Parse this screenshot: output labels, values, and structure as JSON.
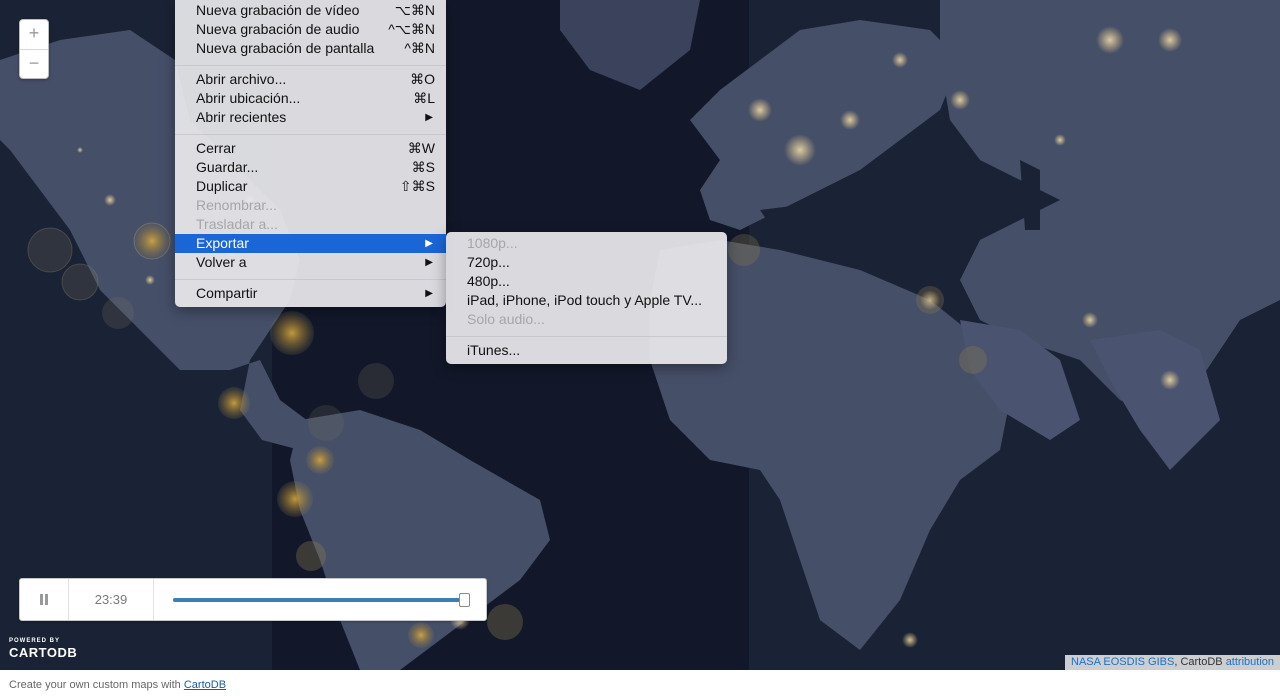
{
  "file_menu": {
    "items": [
      {
        "label": "Nueva grabación de vídeo",
        "shortcut": "⌥⌘N",
        "enabled": true
      },
      {
        "label": "Nueva grabación de audio",
        "shortcut": "^⌥⌘N",
        "enabled": true
      },
      {
        "label": "Nueva grabación de pantalla",
        "shortcut": "^⌘N",
        "enabled": true
      },
      {
        "label": "Abrir archivo...",
        "shortcut": "⌘O",
        "enabled": true
      },
      {
        "label": "Abrir ubicación...",
        "shortcut": "⌘L",
        "enabled": true
      },
      {
        "label": "Abrir recientes",
        "shortcut": "",
        "enabled": true,
        "submenu": true
      },
      {
        "label": "Cerrar",
        "shortcut": "⌘W",
        "enabled": true
      },
      {
        "label": "Guardar...",
        "shortcut": "⌘S",
        "enabled": true
      },
      {
        "label": "Duplicar",
        "shortcut": "⇧⌘S",
        "enabled": true
      },
      {
        "label": "Renombrar...",
        "shortcut": "",
        "enabled": false
      },
      {
        "label": "Trasladar a...",
        "shortcut": "",
        "enabled": false
      },
      {
        "label": "Exportar",
        "shortcut": "",
        "enabled": true,
        "submenu": true,
        "highlighted": true
      },
      {
        "label": "Volver a",
        "shortcut": "",
        "enabled": true,
        "submenu": true
      },
      {
        "label": "Compartir",
        "shortcut": "",
        "enabled": true,
        "submenu": true
      }
    ],
    "submenu_arrow": "▶"
  },
  "export_submenu": {
    "items": [
      {
        "label": "1080p...",
        "enabled": false
      },
      {
        "label": "720p...",
        "enabled": true
      },
      {
        "label": "480p...",
        "enabled": true
      },
      {
        "label": "iPad, iPhone, iPod touch y Apple TV...",
        "enabled": true
      },
      {
        "label": "Solo audio...",
        "enabled": false
      },
      {
        "label": "iTunes...",
        "enabled": true
      }
    ]
  },
  "map": {
    "zoom_in": "+",
    "zoom_out": "−",
    "time_display": "23:39",
    "progress": 0.99,
    "logo_powered": "POWERED BY",
    "logo_name": "CARTODB",
    "attribution_source": "NASA EOSDIS GIBS",
    "attribution_sep": ", CartoDB ",
    "attribution_link": "attribution",
    "pause_icon": "pause-icon"
  },
  "footer": {
    "text": "Create your own custom maps with ",
    "link": "CartoDB"
  },
  "colors": {
    "menu_highlight": "#1a66d6",
    "slider_fill": "#3d7fb3",
    "ocean": "#1a2235",
    "land": "#454f68",
    "city_lights": "#ffd98a"
  }
}
